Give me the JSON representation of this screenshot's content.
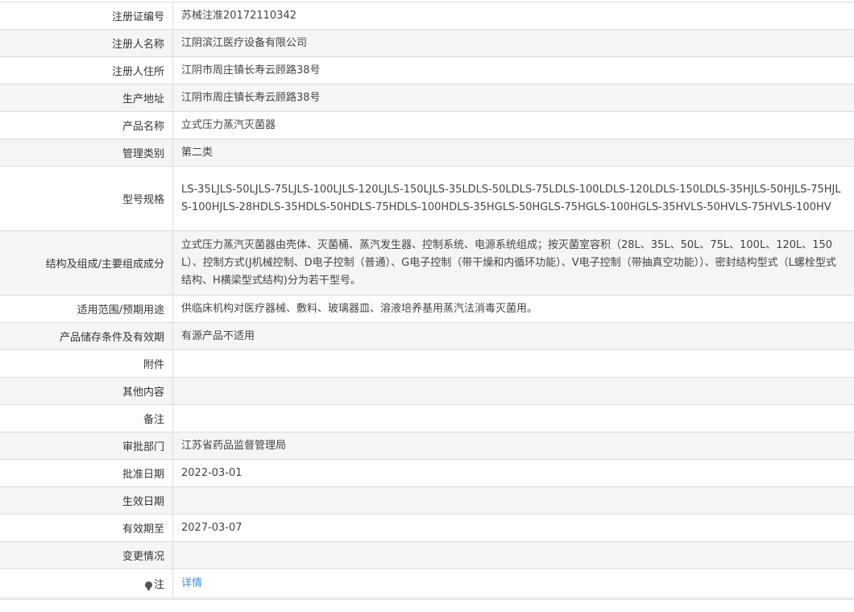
{
  "rows": [
    {
      "label": "注册证编号",
      "value": "苏械注准20172110342"
    },
    {
      "label": "注册人名称",
      "value": "江阴滨江医疗设备有限公司"
    },
    {
      "label": "注册人住所",
      "value": "江阴市周庄镇长寿云顾路38号"
    },
    {
      "label": "生产地址",
      "value": "江阴市周庄镇长寿云顾路38号"
    },
    {
      "label": "产品名称",
      "value": "立式压力蒸汽灭菌器"
    },
    {
      "label": "管理类别",
      "value": "第二类"
    },
    {
      "label": "型号规格",
      "value": "LS-35LJLS-50LJLS-75LJLS-100LJLS-120LJLS-150LJLS-35LDLS-50LDLS-75LDLS-100LDLS-120LDLS-150LDLS-35HJLS-50HJLS-75HJLS-100HJLS-28HDLS-35HDLS-50HDLS-75HDLS-100HDLS-35HGLS-50HGLS-75HGLS-100HGLS-35HVLS-50HVLS-75HVLS-100HV"
    },
    {
      "label": "结构及组成/主要组成成分",
      "value": "立式压力蒸汽灭菌器由壳体、灭菌桶、蒸汽发生器、控制系统、电源系统组成；按灭菌室容积（28L、35L、50L、75L、100L、120L、150L）、控制方式(J机械控制、D电子控制（普通）、G电子控制（带干燥和内循环功能）、V电子控制（带抽真空功能））、密封结构型式（L螺栓型式结构、H横梁型式结构)分为若干型号。"
    },
    {
      "label": "适用范围/预期用途",
      "value": "供临床机构对医疗器械、敷料、玻璃器皿、溶液培养基用蒸汽法消毒灭菌用。"
    },
    {
      "label": "产品储存条件及有效期",
      "value": "有源产品不适用"
    },
    {
      "label": "附件",
      "value": ""
    },
    {
      "label": "其他内容",
      "value": ""
    },
    {
      "label": "备注",
      "value": ""
    },
    {
      "label": "审批部门",
      "value": "江苏省药品监督管理局"
    },
    {
      "label": "批准日期",
      "value": "2022-03-01"
    },
    {
      "label": "生效日期",
      "value": ""
    },
    {
      "label": "有效期至",
      "value": "2027-03-07"
    },
    {
      "label": "变更情况",
      "value": ""
    }
  ],
  "note_row": {
    "icon": "lightbulb-icon",
    "label": "注",
    "link_text": "详情",
    "link_color": "#3a8ee6"
  }
}
